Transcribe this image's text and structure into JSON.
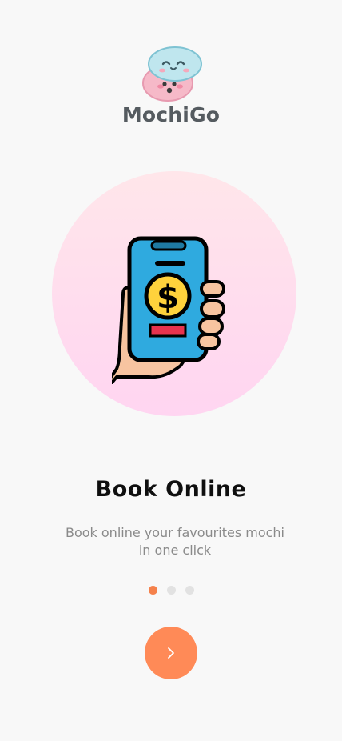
{
  "app": {
    "brand_name": "MochiGo",
    "logo_icon": "mochi-icon"
  },
  "onboarding": {
    "illustration_icon": "phone-payment-icon",
    "title": "Book Online",
    "subtitle": "Book online your favourites mochi in one click",
    "page_indicator": {
      "total": 3,
      "active_index": 0
    },
    "next_button_icon": "chevron-right-icon"
  },
  "colors": {
    "accent": "#ff8a57",
    "dot_active": "#f5814b",
    "dot_inactive": "#e2e2e2",
    "circle_top": "#ffe6ea",
    "circle_bottom": "#ffd5f1",
    "title": "#0f0f0f",
    "subtitle": "#8a8a8a",
    "background": "#f8f8f8"
  }
}
